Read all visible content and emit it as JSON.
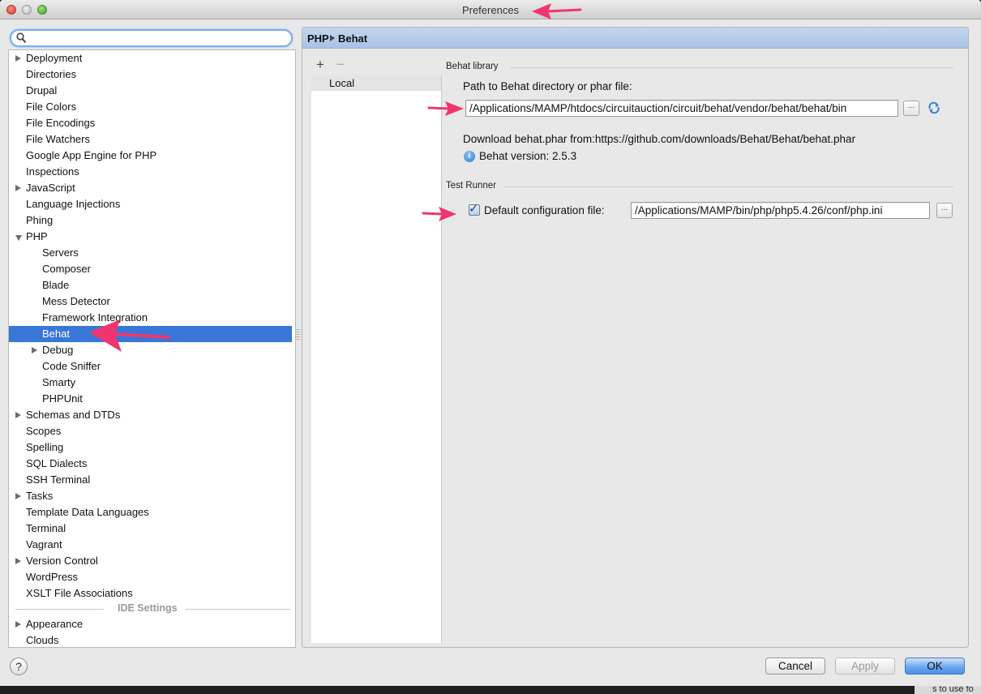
{
  "window": {
    "title": "Preferences"
  },
  "search": {
    "value": "",
    "placeholder": ""
  },
  "tree": {
    "items": [
      {
        "label": "Deployment",
        "expander": "collapsed",
        "depth": 0
      },
      {
        "label": "Directories",
        "expander": "none",
        "depth": 0
      },
      {
        "label": "Drupal",
        "expander": "none",
        "depth": 0
      },
      {
        "label": "File Colors",
        "expander": "none",
        "depth": 0
      },
      {
        "label": "File Encodings",
        "expander": "none",
        "depth": 0
      },
      {
        "label": "File Watchers",
        "expander": "none",
        "depth": 0
      },
      {
        "label": "Google App Engine for PHP",
        "expander": "none",
        "depth": 0
      },
      {
        "label": "Inspections",
        "expander": "none",
        "depth": 0
      },
      {
        "label": "JavaScript",
        "expander": "collapsed",
        "depth": 0
      },
      {
        "label": "Language Injections",
        "expander": "none",
        "depth": 0
      },
      {
        "label": "Phing",
        "expander": "none",
        "depth": 0
      },
      {
        "label": "PHP",
        "expander": "expanded",
        "depth": 0
      },
      {
        "label": "Servers",
        "expander": "none",
        "depth": 1
      },
      {
        "label": "Composer",
        "expander": "none",
        "depth": 1
      },
      {
        "label": "Blade",
        "expander": "none",
        "depth": 1
      },
      {
        "label": "Mess Detector",
        "expander": "none",
        "depth": 1
      },
      {
        "label": "Framework Integration",
        "expander": "none",
        "depth": 1
      },
      {
        "label": "Behat",
        "expander": "none",
        "depth": 1,
        "selected": true
      },
      {
        "label": "Debug",
        "expander": "collapsed",
        "depth": 1
      },
      {
        "label": "Code Sniffer",
        "expander": "none",
        "depth": 1
      },
      {
        "label": "Smarty",
        "expander": "none",
        "depth": 1
      },
      {
        "label": "PHPUnit",
        "expander": "none",
        "depth": 1
      },
      {
        "label": "Schemas and DTDs",
        "expander": "collapsed",
        "depth": 0
      },
      {
        "label": "Scopes",
        "expander": "none",
        "depth": 0
      },
      {
        "label": "Spelling",
        "expander": "none",
        "depth": 0
      },
      {
        "label": "SQL Dialects",
        "expander": "none",
        "depth": 0
      },
      {
        "label": "SSH Terminal",
        "expander": "none",
        "depth": 0
      },
      {
        "label": "Tasks",
        "expander": "collapsed",
        "depth": 0
      },
      {
        "label": "Template Data Languages",
        "expander": "none",
        "depth": 0
      },
      {
        "label": "Terminal",
        "expander": "none",
        "depth": 0
      },
      {
        "label": "Vagrant",
        "expander": "none",
        "depth": 0
      },
      {
        "label": "Version Control",
        "expander": "collapsed",
        "depth": 0
      },
      {
        "label": "WordPress",
        "expander": "none",
        "depth": 0
      },
      {
        "label": "XSLT File Associations",
        "expander": "none",
        "depth": 0
      }
    ],
    "ide_separator": "IDE Settings",
    "ide_items": [
      {
        "label": "Appearance",
        "expander": "collapsed",
        "depth": 0
      },
      {
        "label": "Clouds",
        "expander": "none",
        "depth": 0
      }
    ]
  },
  "breadcrumb": {
    "parent": "PHP",
    "current": "Behat"
  },
  "interpreters": {
    "add_label": "+",
    "remove_label": "−",
    "items": [
      "Local"
    ]
  },
  "behat_library": {
    "group_title": "Behat library",
    "path_label": "Path to Behat directory or phar file:",
    "path_value": "/Applications/MAMP/htdocs/circuitauction/circuit/behat/vendor/behat/behat/bin",
    "browse_label": "...",
    "download_text": "Download behat.phar from:https://github.com/downloads/Behat/Behat/behat.phar",
    "version_text": "Behat version: 2.5.3"
  },
  "test_runner": {
    "group_title": "Test Runner",
    "default_config_checked": true,
    "default_config_label": "Default configuration file:",
    "default_config_value": "/Applications/MAMP/bin/php/php5.4.26/conf/php.ini",
    "browse_label": "..."
  },
  "buttons": {
    "help": "?",
    "cancel": "Cancel",
    "apply": "Apply",
    "ok": "OK"
  },
  "background_text": "s to use fo",
  "colors": {
    "selection": "#3876d8",
    "annotation_arrow": "#f0356e",
    "breadcrumb_bg": "#b3c9ea",
    "ok_button": "#5a9bec"
  }
}
